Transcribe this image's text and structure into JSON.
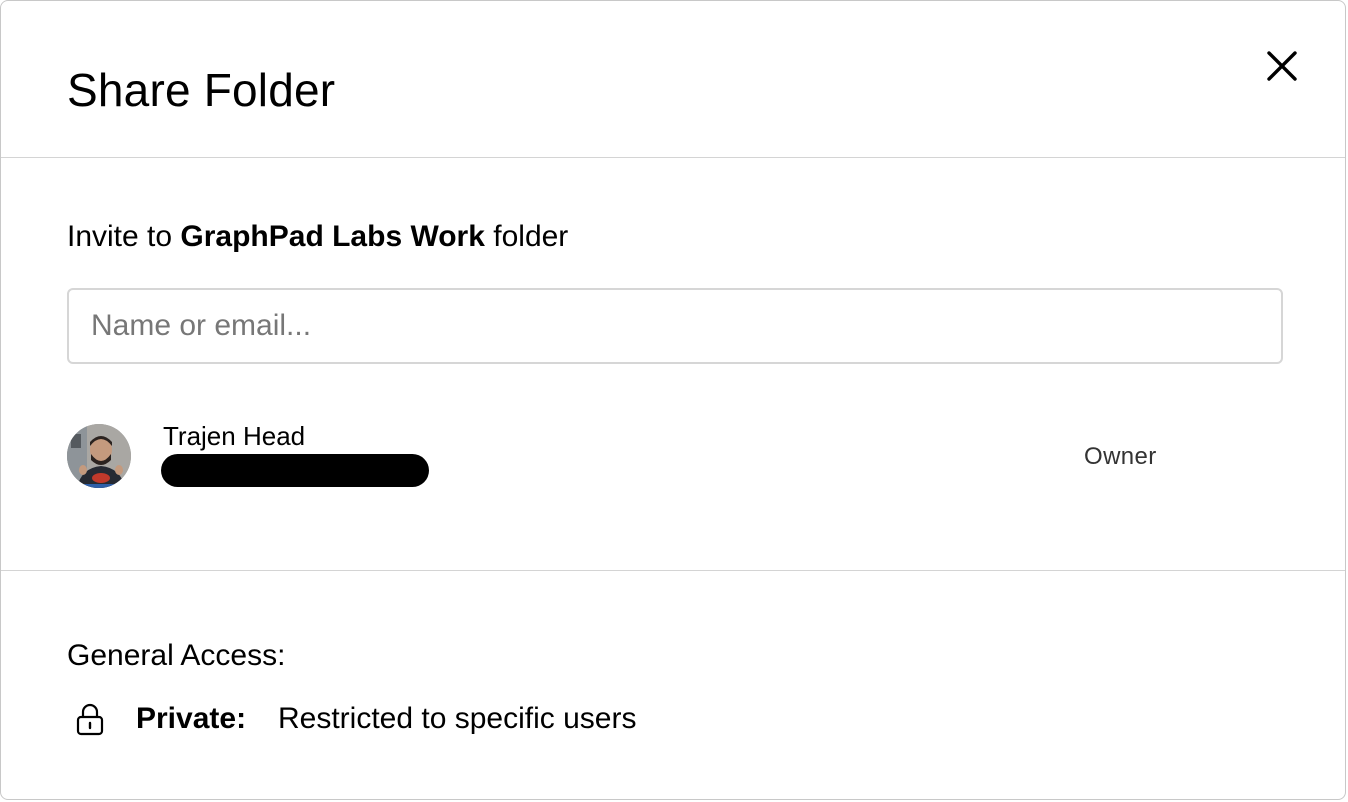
{
  "dialog": {
    "title": "Share Folder",
    "close_icon": "close-icon"
  },
  "invite": {
    "prefix": "Invite to ",
    "folder_name": "GraphPad Labs Work",
    "suffix": " folder",
    "input_placeholder": "Name or email...",
    "input_value": ""
  },
  "members": [
    {
      "name": "Trajen Head",
      "email_redacted": true,
      "role": "Owner",
      "avatar": "user-photo"
    }
  ],
  "general_access": {
    "heading": "General Access:",
    "icon": "lock-icon",
    "level": "Private:",
    "description": "Restricted to specific users"
  }
}
